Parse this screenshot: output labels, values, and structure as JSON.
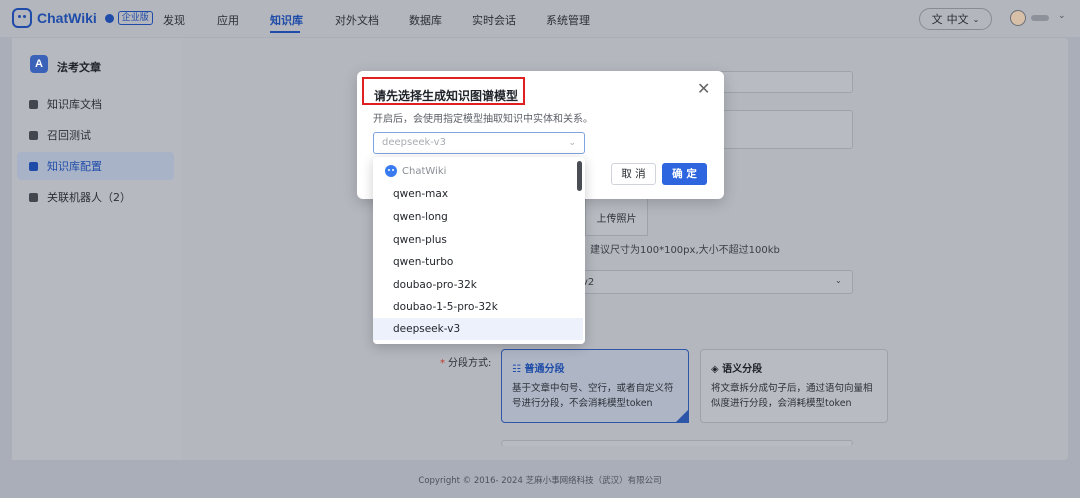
{
  "header": {
    "brand": "ChatWiki",
    "edition_badge": "企业版",
    "nav": [
      "发现",
      "应用",
      "知识库",
      "对外文档",
      "数据库",
      "实时会话",
      "系统管理"
    ],
    "active_nav": "知识库",
    "language": "中文",
    "language_icon": "translate-icon"
  },
  "sidebar": {
    "kb_initial": "A",
    "kb_name": "法考文章",
    "items": [
      "知识库文档",
      "召回测试",
      "知识库配置",
      "关联机器人（2）"
    ],
    "active_item": "知识库配置"
  },
  "form": {
    "upload_button": "上传照片",
    "upload_hint": "建议尺寸为100*100px,大小不超过100kb",
    "model_select_partial": "v2",
    "segment_label": "分段方式:",
    "segment_options": [
      {
        "title": "普通分段",
        "desc": "基于文章中句号、空行，或者自定义符号进行分段，不会消耗模型token",
        "icon": "list-icon"
      },
      {
        "title": "语义分段",
        "desc": "将文章拆分成句子后，通过语句向量相似度进行分段，会消耗模型token",
        "icon": "cube-icon"
      }
    ]
  },
  "modal": {
    "title": "请先选择生成知识图谱模型",
    "description": "开启后，会使用指定模型抽取知识中实体和关系。",
    "select_value": "deepseek-v3",
    "cancel_label": "取 消",
    "ok_label": "确 定",
    "highlight_color": "#e02020"
  },
  "dropdown": {
    "group_label": "ChatWiki",
    "options": [
      "qwen-max",
      "qwen-long",
      "qwen-plus",
      "qwen-turbo",
      "doubao-pro-32k",
      "doubao-1-5-pro-32k",
      "deepseek-v3"
    ],
    "selected": "deepseek-v3"
  },
  "footer": {
    "copyright": "Copyright © 2016- 2024 芝麻小事网络科技（武汉）有限公司"
  }
}
